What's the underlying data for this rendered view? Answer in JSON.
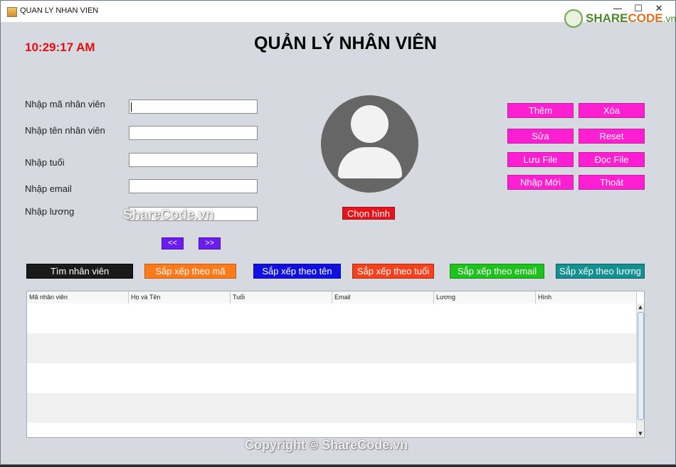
{
  "window": {
    "title": "QUAN LY NHAN VIEN",
    "minimize": "—",
    "maximize": "☐",
    "close": "✕"
  },
  "logo": {
    "part1": "SHARE",
    "part2": "CODE",
    "part3": ".vn"
  },
  "clock": "10:29:17 AM",
  "page_title": "QUẢN LÝ NHÂN VIÊN",
  "form": {
    "labels": [
      "Nhập mã nhân viên",
      "Nhập tên nhân viên",
      "Nhập tuổi",
      "Nhập email",
      "Nhập lương"
    ],
    "values": [
      "",
      "",
      "",
      "",
      ""
    ]
  },
  "photo": {
    "choose_label": "Chọn hình"
  },
  "actions": {
    "them": "Thêm",
    "xoa": "Xóa",
    "sua": "Sửa",
    "reset": "Reset",
    "luu_file": "Lưu File",
    "doc_file": "Đọc File",
    "nhap_moi": "Nhập Mới",
    "thoat": "Thoát"
  },
  "nav": {
    "prev": "<<",
    "next": ">>"
  },
  "toolbar": {
    "tim": "Tìm nhân viên",
    "sort_ma": "Sắp xếp theo mã",
    "sort_ten": "Sắp xếp theo tên",
    "sort_tuoi": "Sắp xếp theo tuổi",
    "sort_email": "Sắp xếp theo email",
    "sort_luong": "Sắp xếp theo lương"
  },
  "table": {
    "columns": [
      "Mã nhân viên",
      "Họ và Tên",
      "Tuổi",
      "Email",
      "Lương",
      "Hình"
    ]
  },
  "watermarks": {
    "center": "ShareCode.vn",
    "copyright": "Copyright © ShareCode.vn"
  },
  "colors": {
    "accent_pink": "#ff1fd2",
    "clock_red": "#e01010",
    "btn_black": "#1a1a1a",
    "btn_orange": "#ff7a1a",
    "btn_blue": "#1010e0",
    "btn_red_orange": "#f5421c",
    "btn_green": "#1dc21d",
    "btn_teal": "#139091",
    "nav_purple": "#6b1cf0",
    "choose_red": "#e8141b"
  }
}
